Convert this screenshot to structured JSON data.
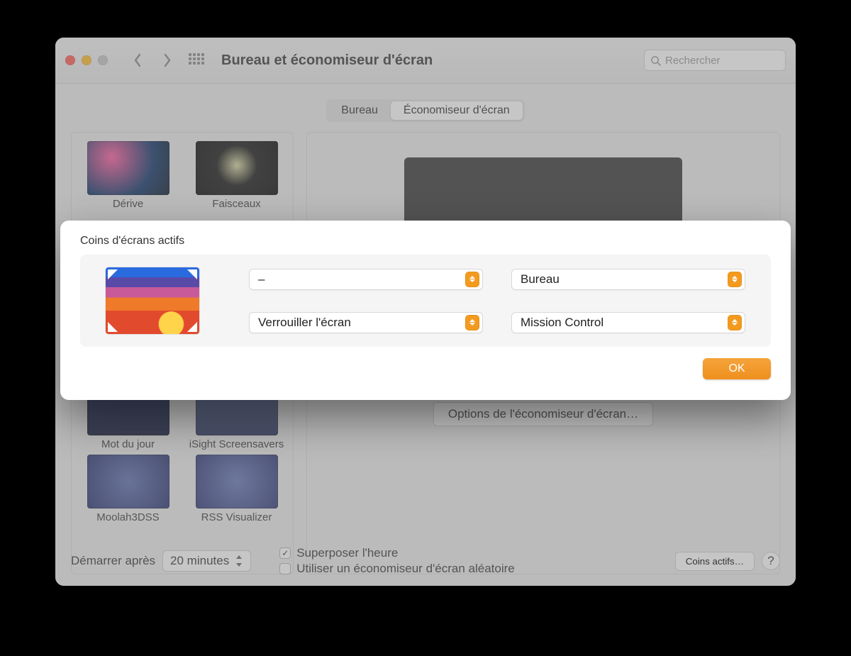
{
  "window": {
    "title": "Bureau et économiseur d'écran",
    "search_placeholder": "Rechercher"
  },
  "tabs": {
    "desktop": "Bureau",
    "screensaver": "Économiseur d'écran"
  },
  "savers": [
    {
      "label": "Dérive"
    },
    {
      "label": "Faisceaux"
    },
    {
      "label": "Mot du jour"
    },
    {
      "label": "iSight Screensavers"
    },
    {
      "label": "Moolah3DSS"
    },
    {
      "label": "RSS Visualizer"
    }
  ],
  "options_button": "Options de l'économiseur d'écran…",
  "start_after": {
    "label": "Démarrer après",
    "value": "20 minutes"
  },
  "checks": {
    "overlay_clock": {
      "label": "Superposer l'heure",
      "checked": true
    },
    "random": {
      "label": "Utiliser un économiseur d'écran aléatoire",
      "checked": false
    }
  },
  "corners_button": "Coins actifs…",
  "help": "?",
  "sheet": {
    "title": "Coins d'écrans actifs",
    "top_left": "–",
    "top_right": "Bureau",
    "bottom_left": "Verrouiller l'écran",
    "bottom_right": "Mission Control",
    "ok": "OK"
  }
}
